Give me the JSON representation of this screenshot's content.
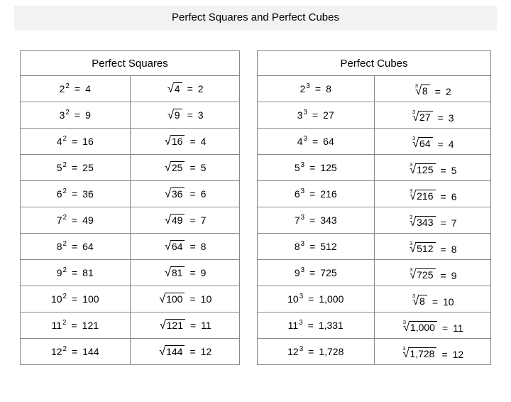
{
  "title": "Perfect Squares and Perfect Cubes",
  "squares": {
    "header": "Perfect Squares",
    "exp": "2",
    "rootIndex": "",
    "rows": [
      {
        "base": "2",
        "pow": "4",
        "rad": "4",
        "root": "2"
      },
      {
        "base": "3",
        "pow": "9",
        "rad": "9",
        "root": "3"
      },
      {
        "base": "4",
        "pow": "16",
        "rad": "16",
        "root": "4"
      },
      {
        "base": "5",
        "pow": "25",
        "rad": "25",
        "root": "5"
      },
      {
        "base": "6",
        "pow": "36",
        "rad": "36",
        "root": "6"
      },
      {
        "base": "7",
        "pow": "49",
        "rad": "49",
        "root": "7"
      },
      {
        "base": "8",
        "pow": "64",
        "rad": "64",
        "root": "8"
      },
      {
        "base": "9",
        "pow": "81",
        "rad": "81",
        "root": "9"
      },
      {
        "base": "10",
        "pow": "100",
        "rad": "100",
        "root": "10"
      },
      {
        "base": "11",
        "pow": "121",
        "rad": "121",
        "root": "11"
      },
      {
        "base": "12",
        "pow": "144",
        "rad": "144",
        "root": "12"
      }
    ]
  },
  "cubes": {
    "header": "Perfect Cubes",
    "exp": "3",
    "rootIndex": "3",
    "rows": [
      {
        "base": "2",
        "pow": "8",
        "rad": "8",
        "root": "2"
      },
      {
        "base": "3",
        "pow": "27",
        "rad": "27",
        "root": "3"
      },
      {
        "base": "4",
        "pow": "64",
        "rad": "64",
        "root": "4"
      },
      {
        "base": "5",
        "pow": "125",
        "rad": "125",
        "root": "5"
      },
      {
        "base": "6",
        "pow": "216",
        "rad": "216",
        "root": "6"
      },
      {
        "base": "7",
        "pow": "343",
        "rad": "343",
        "root": "7"
      },
      {
        "base": "8",
        "pow": "512",
        "rad": "512",
        "root": "8"
      },
      {
        "base": "9",
        "pow": "725",
        "rad": "725",
        "root": "9"
      },
      {
        "base": "10",
        "pow": "1,000",
        "rad": "8",
        "root": "10"
      },
      {
        "base": "11",
        "pow": "1,331",
        "rad": "1,000",
        "root": "11"
      },
      {
        "base": "12",
        "pow": "1,728",
        "rad": "1,728",
        "root": "12"
      }
    ]
  }
}
